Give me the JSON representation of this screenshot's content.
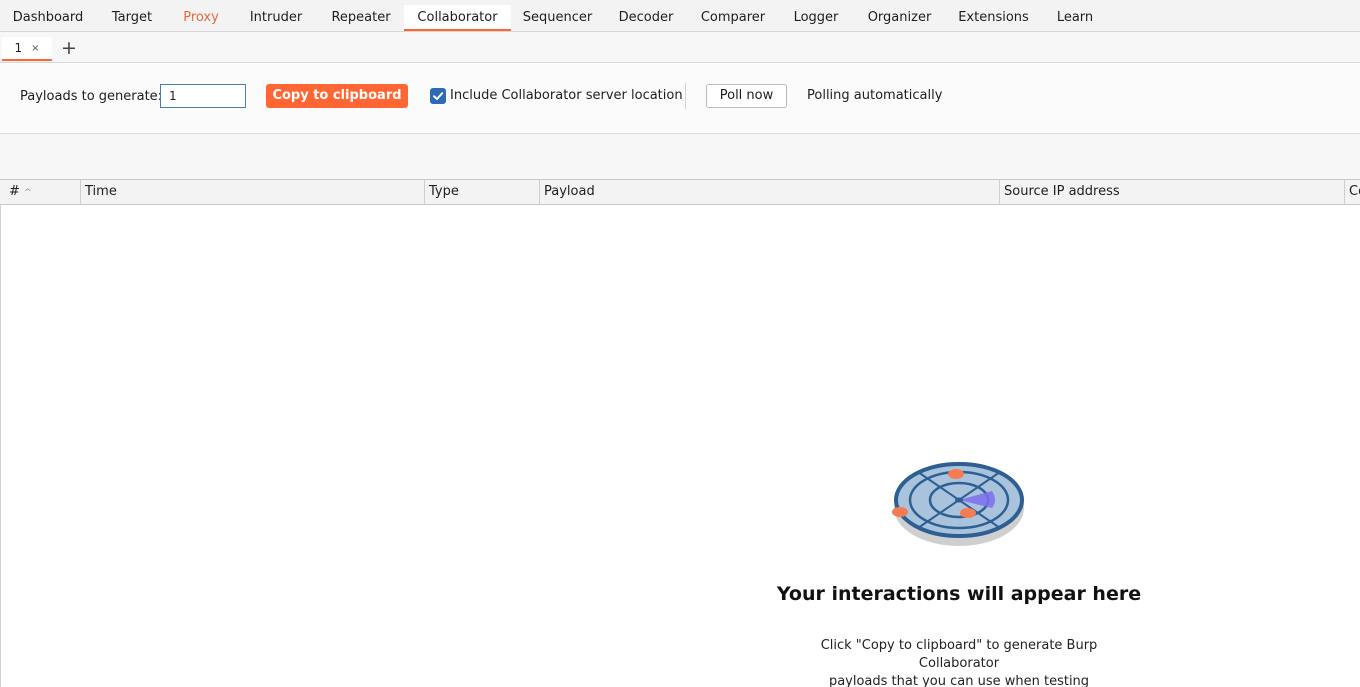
{
  "main_tabs": [
    "Dashboard",
    "Target",
    "Proxy",
    "Intruder",
    "Repeater",
    "Collaborator",
    "Sequencer",
    "Decoder",
    "Comparer",
    "Logger",
    "Organizer",
    "Extensions",
    "Learn"
  ],
  "active_main_tab": "Collaborator",
  "sub_tab": {
    "label": "1",
    "close_glyph": "×",
    "add_glyph": "+"
  },
  "toolbar": {
    "payloads_label": "Payloads to generate:",
    "payloads_value": "1",
    "copy_button": "Copy to clipboard",
    "include_location_label": "Include Collaborator server location",
    "include_location_checked": true,
    "poll_button": "Poll now",
    "polling_status": "Polling automatically"
  },
  "table": {
    "columns": [
      "#",
      "Time",
      "Type",
      "Payload",
      "Source IP address",
      "Co"
    ],
    "sort_indicator": "^",
    "rows": []
  },
  "empty_state": {
    "icon": "radar-icon",
    "title": "Your interactions will appear here",
    "description_line1": "Click \"Copy to clipboard\" to generate Burp Collaborator",
    "description_line2": "payloads that you can use when testing"
  },
  "colors": {
    "accent": "#ff6633",
    "proxy_tab_text": "#e8683c",
    "checkbox": "#2e6bb5",
    "radar_ring": "#2d5f93",
    "radar_dot": "#f47b52"
  }
}
